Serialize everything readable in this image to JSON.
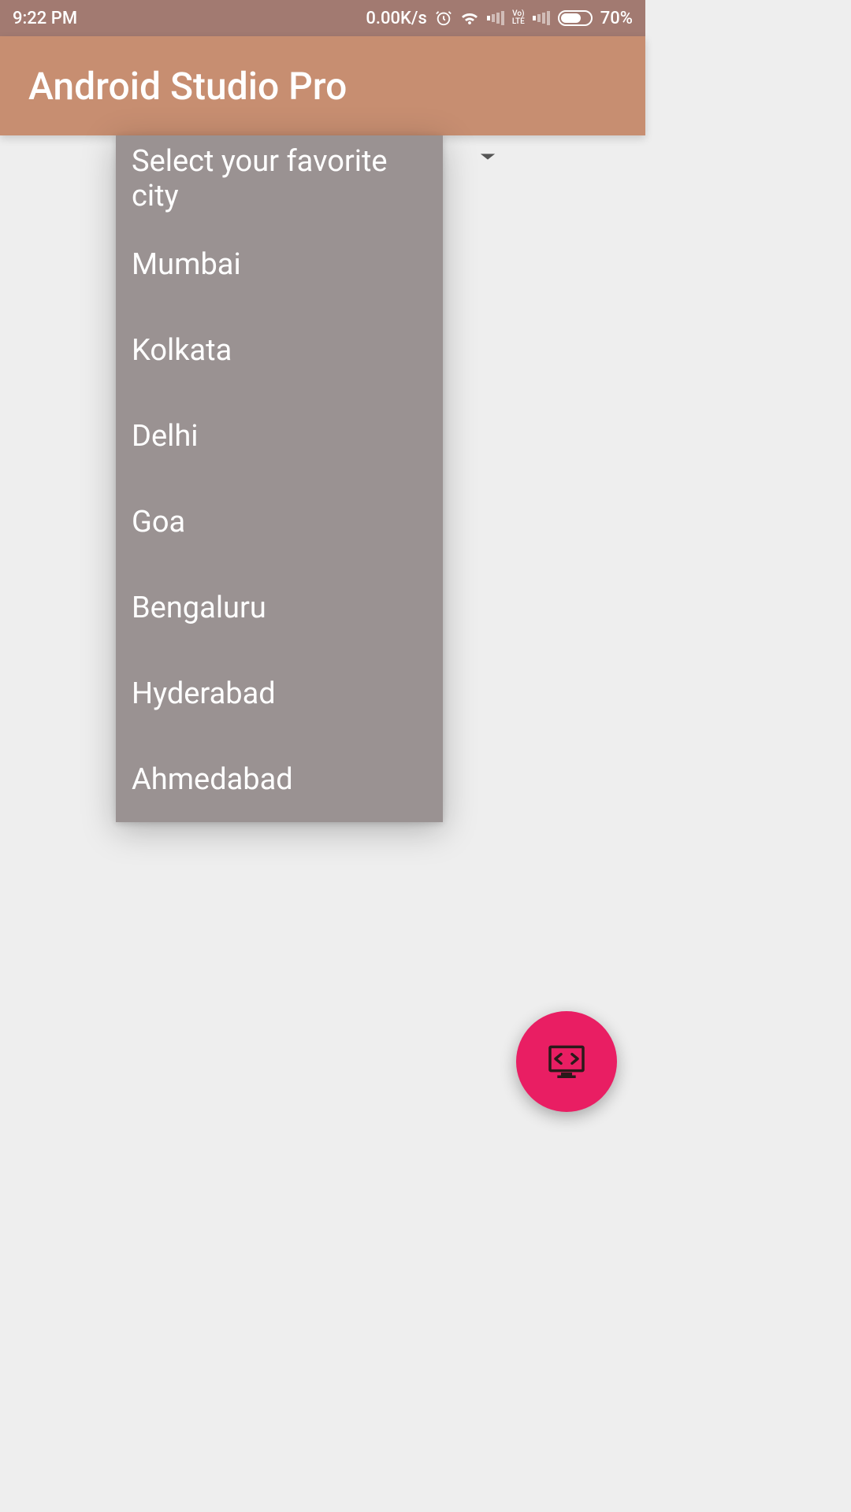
{
  "status": {
    "time": "9:22 PM",
    "speed": "0.00K/s",
    "battery_pct": "70%",
    "volte": "Vo)\nLTE"
  },
  "app_bar": {
    "title": "Android Studio Pro"
  },
  "background": {
    "hint_text_suffix": "city"
  },
  "dropdown": {
    "items": [
      "Select your favorite city",
      "Mumbai",
      "Kolkata",
      "Delhi",
      "Goa",
      "Bengaluru",
      "Hyderabad",
      "Ahmedabad"
    ]
  }
}
